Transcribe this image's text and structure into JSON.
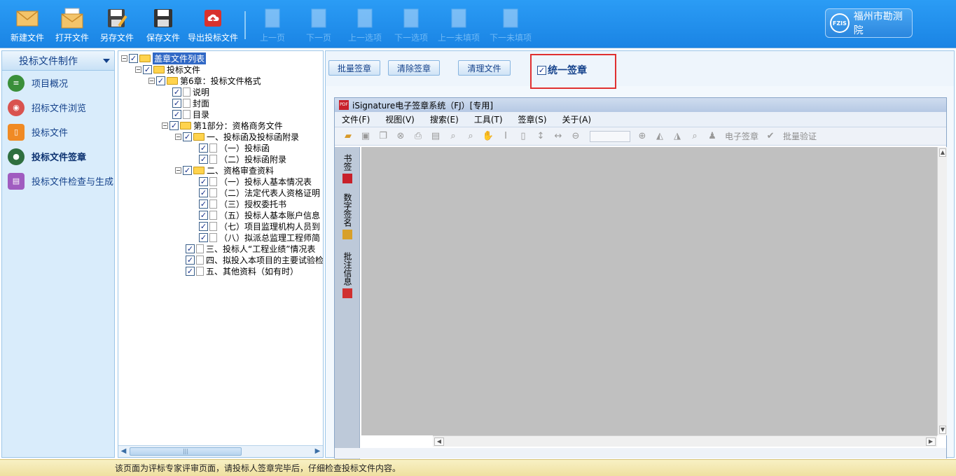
{
  "toolbar": {
    "new_label": "新建文件",
    "open_label": "打开文件",
    "saveas_label": "另存文件",
    "save_label": "保存文件",
    "export_label": "导出投标文件",
    "prev_page": "上一页",
    "next_page": "下一页",
    "prev_item": "上一选项",
    "next_item": "下一选项",
    "prev_unfilled": "上一未填项",
    "next_unfilled": "下一未填项",
    "logo_text": "福州市勘测院",
    "logo_badge": "FZIS"
  },
  "sidebar": {
    "header": "投标文件制作",
    "items": [
      {
        "label": "项目概况",
        "color": "#3a8f3a"
      },
      {
        "label": "招标文件浏览",
        "color": "#d9534f"
      },
      {
        "label": "投标文件",
        "color": "#f08a24"
      },
      {
        "label": "投标文件签章",
        "color": "#2f6f3f"
      },
      {
        "label": "投标文件检查与生成",
        "color": "#a05cc0"
      }
    ]
  },
  "tree": {
    "root": "盖章文件列表",
    "n1": "投标文件",
    "n2": "第6章：投标文件格式",
    "n3": "说明",
    "n4": "封面",
    "n5": "目录",
    "n6": "第1部分：资格商务文件",
    "n7": "一、投标函及投标函附录",
    "n8": "（一）投标函",
    "n9": "（二）投标函附录",
    "n10": "二、资格审查资料",
    "n11": "（一）投标人基本情况表",
    "n12": "（二）法定代表人资格证明",
    "n13": "（三）授权委托书",
    "n14": "（五）投标人基本账户信息",
    "n15": "（七）项目监理机构人员到",
    "n16": "（八）拟派总监理工程师简",
    "n17": "三、投标人“工程业绩”情况表",
    "n18": "四、拟投入本项目的主要试验检",
    "n19": "五、其他资料（如有时）",
    "check": "✓"
  },
  "actions": {
    "batch_sign": "批量签章",
    "clear_sign": "清除签章",
    "clean_file": "清理文件",
    "unify_label": "统一签章"
  },
  "isig": {
    "title": "iSignature电子签章系统（FJ）[专用]",
    "menus": [
      "文件(F)",
      "视图(V)",
      "搜索(E)",
      "工具(T)",
      "签章(S)",
      "关于(A)"
    ],
    "tool_esign": "电子签章",
    "tool_batch_verify": "批量验证",
    "tabs": [
      "书签",
      "数字签名",
      "批注信息"
    ]
  },
  "footer": {
    "message": "该页面为评标专家评审页面，请投标人签章完毕后，仔细检查投标文件内容。"
  }
}
